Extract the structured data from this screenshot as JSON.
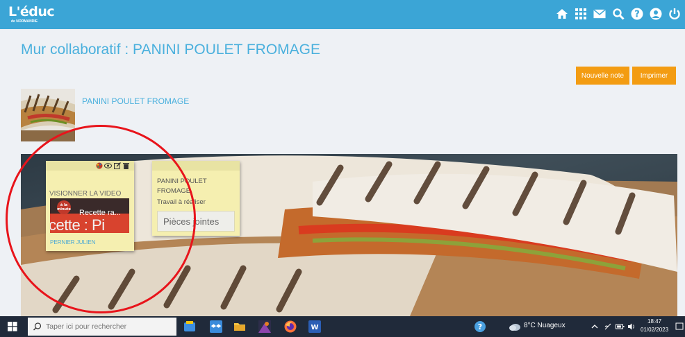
{
  "header": {
    "logo_main": "L'éduc",
    "logo_sub": "de NORMANDIE",
    "icons": [
      "home-icon",
      "grid-icon",
      "mail-icon",
      "search-icon",
      "help-icon",
      "user-icon",
      "power-icon"
    ]
  },
  "page": {
    "title": "Mur collaboratif : PANINI POULET FROMAGE",
    "new_note_label": "Nouvelle note",
    "print_label": "Imprimer",
    "thumb_label": "PANINI POULET FROMAGE"
  },
  "notes": [
    {
      "title": "VISIONNER LA VIDEO",
      "video_title": "Recette ra...",
      "video_overlay": "cette : Pi",
      "author": "PERNIER JULIEN"
    },
    {
      "title_line1": "PANINI POULET",
      "title_line2": "FROMAGE",
      "description": "Travail à réaliser",
      "attachments": "Pièces jointes"
    }
  ],
  "taskbar": {
    "search_placeholder": "Taper ici pour rechercher",
    "weather": "8°C  Nuageux",
    "time": "18:47",
    "date": "01/02/2023"
  },
  "colors": {
    "header": "#3ba5d6",
    "title": "#4ab0dd",
    "button": "#f39c12",
    "note": "#f5efb0",
    "annotation": "#e8141b",
    "taskbar": "#202a3a"
  }
}
